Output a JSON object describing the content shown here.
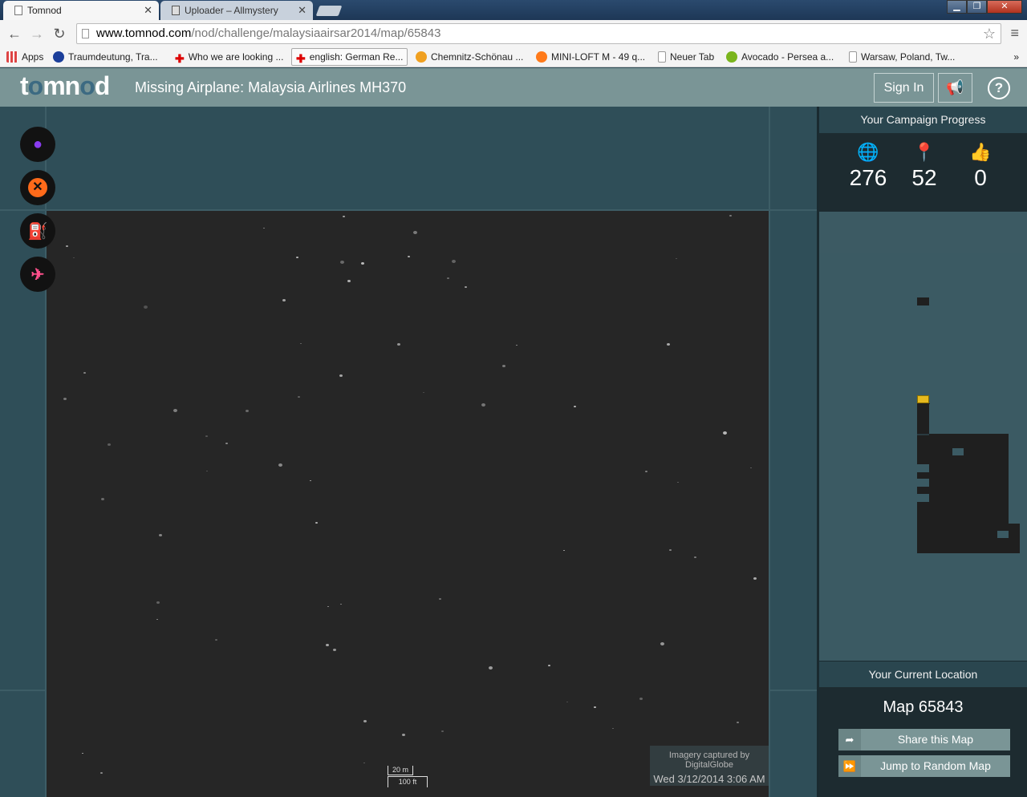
{
  "browser": {
    "tabs": [
      {
        "label": "Tomnod",
        "active": true
      },
      {
        "label": "Uploader – Allmystery",
        "active": false
      }
    ],
    "url_host": "www.tomnod.com",
    "url_path": "/nod/challenge/malaysiaairsar2014/map/65843",
    "bookmarks": [
      {
        "label": "Apps",
        "icon": "apps-grid-icon"
      },
      {
        "label": "Traumdeutung, Tra...",
        "icon": "o2-icon"
      },
      {
        "label": "Who we are looking ...",
        "icon": "red-cross-icon"
      },
      {
        "label": "english: German Re...",
        "icon": "red-cross-icon"
      },
      {
        "label": "Chemnitz-Schönau ...",
        "icon": "orange-circle-icon"
      },
      {
        "label": "MINI-LOFT M - 49 q...",
        "icon": "orange-face-icon"
      },
      {
        "label": "Neuer Tab",
        "icon": "page-icon"
      },
      {
        "label": "Avocado - Persea a...",
        "icon": "green-leaf-icon"
      },
      {
        "label": "Warsaw, Poland, Tw...",
        "icon": "page-icon"
      }
    ],
    "bookmarks_more": "»"
  },
  "app": {
    "logo": "tomnod",
    "title": "Missing Airplane: Malaysia Airlines MH370",
    "sign_in": "Sign In",
    "help": "?"
  },
  "tools": [
    {
      "name": "tag-pin-tool",
      "glyph": "⚲",
      "color": "#8a3cf0"
    },
    {
      "name": "tag-wreckage-tool",
      "glyph": "✕",
      "color": "#ff6a1a"
    },
    {
      "name": "tag-oil-slick-tool",
      "glyph": "⛽",
      "color": "#f2d21a"
    },
    {
      "name": "tag-life-raft-tool",
      "glyph": "✈",
      "color": "#ff4f8b"
    }
  ],
  "imagery": {
    "credit": "Imagery captured by DigitalGlobe",
    "date": "Wed 3/12/2014 3:06 AM",
    "scale_metric": "20 m",
    "scale_imperial": "100 ft"
  },
  "sidebar": {
    "progress_title": "Your Campaign Progress",
    "stats": [
      {
        "icon": "globe-icon",
        "value": "276"
      },
      {
        "icon": "map-pin-icon",
        "value": "52"
      },
      {
        "icon": "thumbs-up-icon",
        "value": "0"
      }
    ],
    "location_title": "Your Current Location",
    "map_id": "Map 65843",
    "share_label": "Share this Map",
    "jump_label": "Jump to Random Map"
  }
}
